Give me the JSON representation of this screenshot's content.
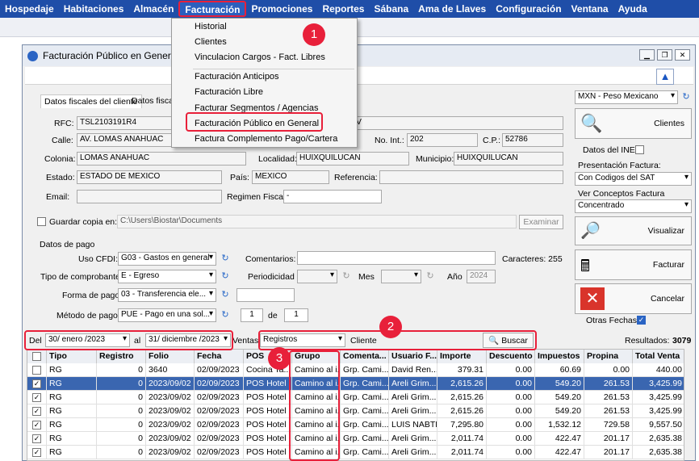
{
  "menubar": {
    "items": [
      "Hospedaje",
      "Habitaciones",
      "Almacén",
      "Facturación",
      "Promociones",
      "Reportes",
      "Sábana",
      "Ama de Llaves",
      "Configuración",
      "Ventana",
      "Ayuda"
    ]
  },
  "menu": {
    "items": [
      "Historial",
      "Clientes",
      "Vinculacion Cargos - Fact. Libres",
      "Facturación Anticipos",
      "Facturación Libre",
      "Facturar Segmentos / Agencias",
      "Facturación Público en General",
      "Factura Complemento Pago/Cartera"
    ]
  },
  "badges": [
    "1",
    "2",
    "3"
  ],
  "window": {
    "title": "Facturación Público en General - C"
  },
  "tabs": [
    "Datos fiscales del cliente",
    "Datos fisca"
  ],
  "fiscal": {
    "rfc_label": "RFC:",
    "rfc": "TSL2103191R4",
    "rfc_suffix": "CV",
    "calle_label": "Calle:",
    "calle": "AV. LOMAS ANAHUAC",
    "noint_label": "No. Int.:",
    "noint": "202",
    "cp_label": "C.P.:",
    "cp": "52786",
    "colonia_label": "Colonia:",
    "colonia": "LOMAS ANAHUAC",
    "localidad_label": "Localidad:",
    "localidad": "HUIXQUILUCAN",
    "municipio_label": "Municipio:",
    "municipio": "HUIXQUILUCAN",
    "estado_label": "Estado:",
    "estado": "ESTADO DE MEXICO",
    "pais_label": "País:",
    "pais": "MEXICO",
    "referencia_label": "Referencia:",
    "email_label": "Email:",
    "regimen_label": "Regimen Fiscal:",
    "regimen": "-"
  },
  "guardar": {
    "label": "Guardar copia en:",
    "path": "C:\\Users\\Biostar\\Documents",
    "examinar": "Examinar"
  },
  "pago": {
    "title": "Datos de pago",
    "uso_label": "Uso CFDI:",
    "uso": "G03 - Gastos en general",
    "comentarios_label": "Comentarios:",
    "caracteres": "Caracteres: 255",
    "tipo_label": "Tipo de comprobante:",
    "tipo": "E - Egreso",
    "periodicidad_label": "Periodicidad",
    "mes_label": "Mes",
    "anio_label": "Año",
    "anio": "2024",
    "forma_label": "Forma de pago:",
    "forma": "03 - Transferencia ele...",
    "metodo_label": "Método de pago:",
    "metodo": "PUE - Pago en una sol...",
    "num1": "1",
    "de_label": "de",
    "num2": "1"
  },
  "right": {
    "moneda": "MXN - Peso Mexicano",
    "clientes": "Clientes",
    "ine": "Datos del INE",
    "presentacion_label": "Presentación Factura:",
    "presentacion": "Con Codigos del SAT",
    "ver_label": "Ver Conceptos Factura",
    "ver": "Concentrado",
    "visualizar": "Visualizar",
    "facturar": "Facturar",
    "cancelar": "Cancelar",
    "otras": "Otras Fechas"
  },
  "filter": {
    "del_label": "Del",
    "from": "30/   enero   /2023",
    "al_label": "al",
    "to": "31/ diciembre /2023",
    "ventas_label": "Ventas",
    "ventas": "Registros",
    "cliente_label": "Cliente",
    "buscar": "Buscar",
    "resultados_label": "Resultados:",
    "resultados": "3079"
  },
  "table": {
    "headers": [
      "Tipo",
      "Registro",
      "Folio",
      "Fecha",
      "POS",
      "Grupo",
      "Comenta...",
      "Usuario F...",
      "Importe",
      "Descuento",
      "Impuestos",
      "Propina",
      "Total Venta"
    ],
    "rows": [
      [
        "RG",
        "0",
        "3640",
        "02/09/2023",
        "Cocina Ta...",
        "Camino al i...",
        "Grp. Cami...",
        "David Ren...",
        "379.31",
        "0.00",
        "60.69",
        "0.00",
        "440.00"
      ],
      [
        "RG",
        "0",
        "2023/09/02",
        "02/09/2023",
        "POS Hotel",
        "Camino al i...",
        "Grp. Cami...",
        "Areli  Grim...",
        "2,615.26",
        "0.00",
        "549.20",
        "261.53",
        "3,425.99"
      ],
      [
        "RG",
        "0",
        "2023/09/02",
        "02/09/2023",
        "POS Hotel",
        "Camino al i...",
        "Grp. Cami...",
        "Areli  Grim...",
        "2,615.26",
        "0.00",
        "549.20",
        "261.53",
        "3,425.99"
      ],
      [
        "RG",
        "0",
        "2023/09/02",
        "02/09/2023",
        "POS Hotel",
        "Camino al i...",
        "Grp. Cami...",
        "Areli  Grim...",
        "2,615.26",
        "0.00",
        "549.20",
        "261.53",
        "3,425.99"
      ],
      [
        "RG",
        "0",
        "2023/09/02",
        "02/09/2023",
        "POS Hotel",
        "Camino al i...",
        "Grp. Cami...",
        "LUIS  NABTE",
        "7,295.80",
        "0.00",
        "1,532.12",
        "729.58",
        "9,557.50"
      ],
      [
        "RG",
        "0",
        "2023/09/02",
        "02/09/2023",
        "POS Hotel",
        "Camino al i...",
        "Grp. Cami...",
        "Areli  Grim...",
        "2,011.74",
        "0.00",
        "422.47",
        "201.17",
        "2,635.38"
      ],
      [
        "RG",
        "0",
        "2023/09/02",
        "02/09/2023",
        "POS Hotel",
        "Camino al i...",
        "Grp. Cami...",
        "Areli  Grim...",
        "2,011.74",
        "0.00",
        "422.47",
        "201.17",
        "2,635.38"
      ]
    ]
  }
}
